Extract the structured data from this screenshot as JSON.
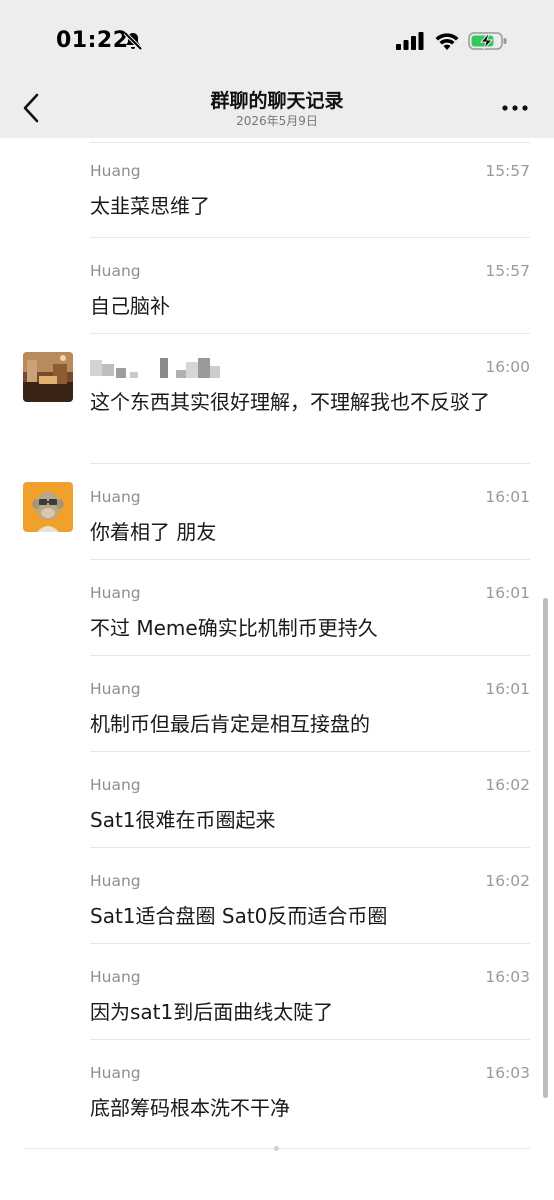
{
  "status": {
    "time": "01:22"
  },
  "nav": {
    "title": "群聊的聊天记录",
    "subtitle": "2026年5月9日"
  },
  "messages": [
    {
      "sender": "Huang",
      "time": "15:57",
      "text": "太韭菜思维了",
      "avatar": "none"
    },
    {
      "sender": "Huang",
      "time": "15:57",
      "text": "自己脑补",
      "avatar": "none"
    },
    {
      "sender": "",
      "time": "16:00",
      "text": "这个东西其实很好理解，不理解我也不反驳了",
      "avatar": "photo"
    },
    {
      "sender": "Huang",
      "time": "16:01",
      "text": "你着相了 朋友",
      "avatar": "ape"
    },
    {
      "sender": "Huang",
      "time": "16:01",
      "text": "不过 Meme确实比机制币更持久",
      "avatar": "none"
    },
    {
      "sender": "Huang",
      "time": "16:01",
      "text": "机制币但最后肯定是相互接盘的",
      "avatar": "none"
    },
    {
      "sender": "Huang",
      "time": "16:02",
      "text": "Sat1很难在币圈起来",
      "avatar": "none"
    },
    {
      "sender": "Huang",
      "time": "16:02",
      "text": "Sat1适合盘圈 Sat0反而适合币圈",
      "avatar": "none"
    },
    {
      "sender": "Huang",
      "time": "16:03",
      "text": "因为sat1到后面曲线太陡了",
      "avatar": "none"
    },
    {
      "sender": "Huang",
      "time": "16:03",
      "text": "底部筹码根本洗不干净",
      "avatar": "none"
    }
  ],
  "colors": {
    "header_bg": "#ededed",
    "battery_green": "#34c759",
    "sender": "#8e8e8e"
  }
}
